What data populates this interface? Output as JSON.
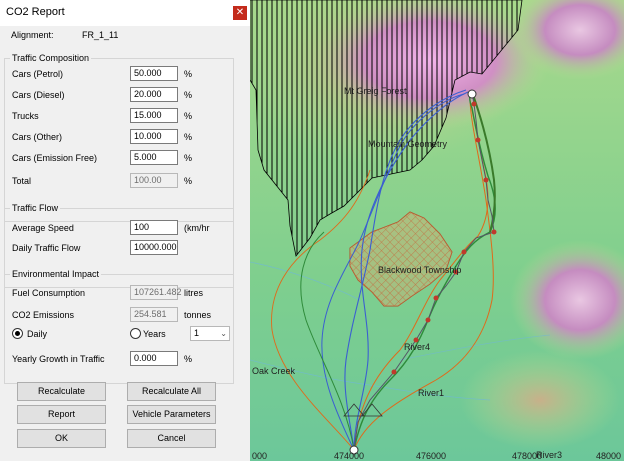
{
  "dialog": {
    "title": "CO2 Report",
    "alignment_label": "Alignment:",
    "alignment_value": "FR_1_11",
    "traffic_composition": {
      "title": "Traffic Composition",
      "rows": [
        {
          "label": "Cars (Petrol)",
          "value": "50.000",
          "unit": "%"
        },
        {
          "label": "Cars (Diesel)",
          "value": "20.000",
          "unit": "%"
        },
        {
          "label": "Trucks",
          "value": "15.000",
          "unit": "%"
        },
        {
          "label": "Cars (Other)",
          "value": "10.000",
          "unit": "%"
        },
        {
          "label": "Cars (Emission Free)",
          "value": "5.000",
          "unit": "%"
        },
        {
          "label": "Total",
          "value": "100.00",
          "unit": "%"
        }
      ]
    },
    "traffic_flow": {
      "title": "Traffic Flow",
      "speed_label": "Average Speed",
      "speed_value": "100",
      "speed_unit": "(km/hr",
      "daily_label": "Daily Traffic Flow",
      "daily_value": "10000.000"
    },
    "environmental": {
      "title": "Environmental Impact",
      "fuel_label": "Fuel Consumption",
      "fuel_value": "107261.482",
      "fuel_unit": "litres",
      "co2_label": "CO2 Emissions",
      "co2_value": "254.581",
      "co2_unit": "tonnes",
      "daily_radio": "Daily",
      "years_radio": "Years",
      "years_value": "1",
      "growth_label": "Yearly Growth in Traffic",
      "growth_value": "0.000",
      "growth_unit": "%"
    },
    "buttons": {
      "recalculate": "Recalculate",
      "recalculate_all": "Recalculate All",
      "report": "Report",
      "vehicle_parameters": "Vehicle Parameters",
      "ok": "OK",
      "cancel": "Cancel"
    }
  },
  "map": {
    "labels": {
      "mt_greig": "Mt Greig Forest",
      "mountain_geometry": "Mountain Geometry",
      "blackwood": "Blackwood Township",
      "river4": "River4",
      "river1": "River1",
      "river3": "River3",
      "oak_creek": "Oak Creek"
    },
    "axis": [
      "000",
      "474000",
      "476000",
      "478000",
      "48000"
    ]
  },
  "colors": {
    "hatch_area": "#000000",
    "township_fill": "#e8a26a",
    "route_main": "#3a7a2a",
    "route_blue": "#3b5fd1",
    "route_orange": "#e06a1a",
    "close_button": "#c42b1c"
  }
}
